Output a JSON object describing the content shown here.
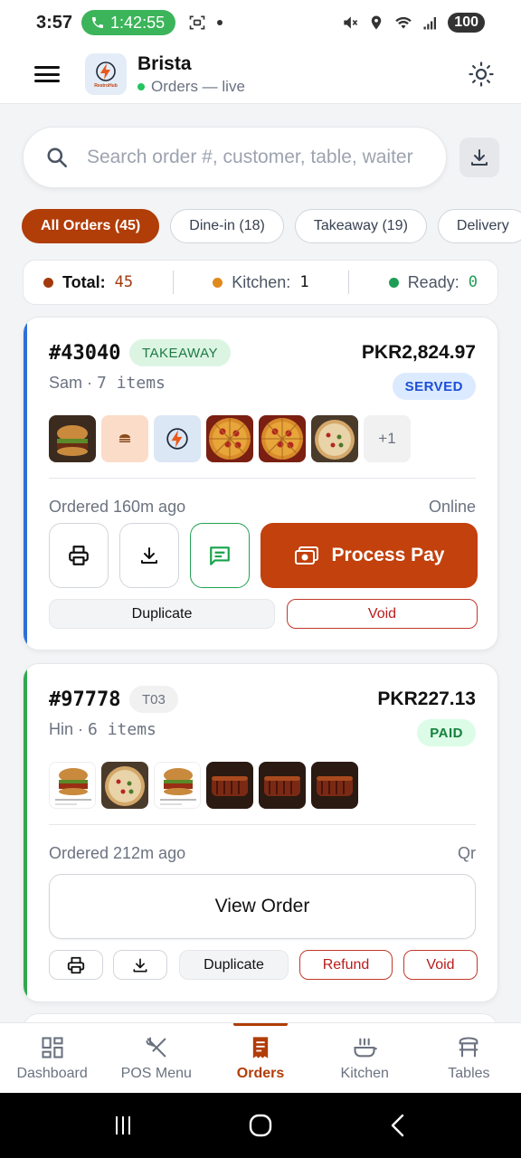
{
  "status_bar": {
    "time": "3:57",
    "call_timer": "1:42:55",
    "battery": "100"
  },
  "header": {
    "brand_name": "Brista",
    "brand_status": "Orders — live",
    "logo_text": "RestroHub"
  },
  "search": {
    "placeholder": "Search order #, customer, table, waiter"
  },
  "filters": [
    {
      "label": "All Orders (45)",
      "active": true
    },
    {
      "label": "Dine-in (18)",
      "active": false
    },
    {
      "label": "Takeaway (19)",
      "active": false
    },
    {
      "label": "Delivery",
      "active": false
    }
  ],
  "summary": {
    "total_label": "Total:",
    "total_value": "45",
    "kitchen_label": "Kitchen:",
    "kitchen_value": "1",
    "ready_label": "Ready:",
    "ready_value": "0",
    "colors": {
      "total": "#a33a0e",
      "kitchen": "#e08a1e",
      "ready": "#1e9e55"
    }
  },
  "orders": [
    {
      "number": "#43040",
      "type_tag": "TAKEAWAY",
      "price": "PKR2,824.97",
      "status": "SERVED",
      "customer": "Sam",
      "items": "7 items",
      "more_count": "+1",
      "ordered": "Ordered 160m ago",
      "channel": "Online",
      "pay_label": "Process Pay",
      "duplicate_label": "Duplicate",
      "void_label": "Void",
      "accent": "#2f6fd6",
      "thumb_icons": [
        "burger",
        "burger-icon",
        "restrohub-logo",
        "pizza",
        "pizza",
        "pizza-veg"
      ]
    },
    {
      "number": "#97778",
      "type_tag": "T03",
      "price": "PKR227.13",
      "status": "PAID",
      "customer": "Hin",
      "items": "6 items",
      "ordered": "Ordered 212m ago",
      "channel": "Qr",
      "view_label": "View Order",
      "duplicate_label": "Duplicate",
      "refund_label": "Refund",
      "void_label": "Void",
      "accent": "#2fa84f",
      "thumb_icons": [
        "burger-card",
        "pizza-veg",
        "burger-card",
        "ribs",
        "ribs",
        "ribs"
      ]
    }
  ],
  "bottom_nav": [
    {
      "label": "Dashboard",
      "icon": "dashboard-icon",
      "active": false
    },
    {
      "label": "POS Menu",
      "icon": "fork-knife-icon",
      "active": false
    },
    {
      "label": "Orders",
      "icon": "receipt-icon",
      "active": true
    },
    {
      "label": "Kitchen",
      "icon": "pot-icon",
      "active": false
    },
    {
      "label": "Tables",
      "icon": "table-icon",
      "active": false
    }
  ]
}
